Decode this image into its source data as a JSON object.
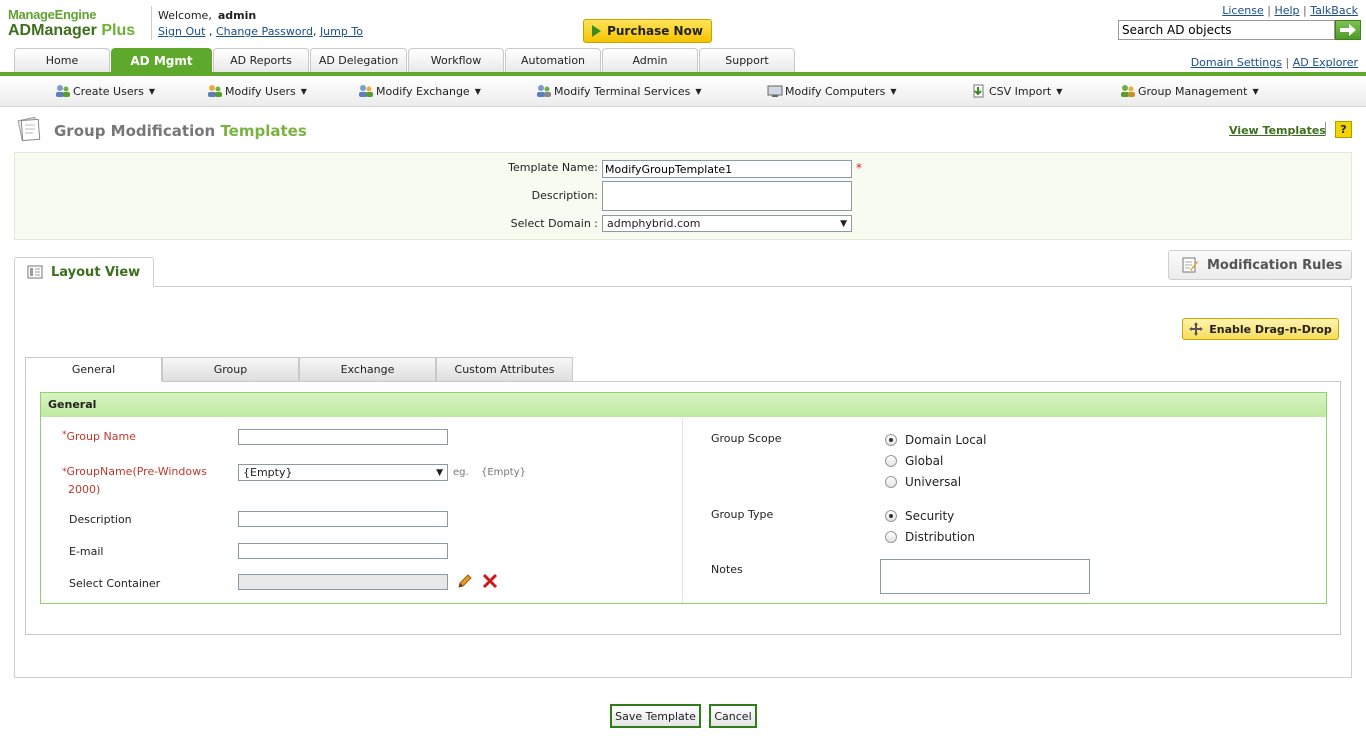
{
  "brand": {
    "top": "ManageEngine",
    "bottom": "ADManager",
    "plus": "Plus"
  },
  "header": {
    "welcome_text": "Welcome,",
    "username": "admin",
    "sign_out": "Sign Out",
    "change_password": "Change Password",
    "jump_to": "Jump To",
    "purchase": "Purchase Now",
    "license": "License",
    "help": "Help",
    "talkback": "TalkBack",
    "search_value": "Search AD objects",
    "domain_settings": "Domain Settings",
    "ad_explorer": "AD Explorer"
  },
  "main_tabs": [
    "Home",
    "AD Mgmt",
    "AD Reports",
    "AD Delegation",
    "Workflow",
    "Automation",
    "Admin",
    "Support"
  ],
  "active_main_tab": "AD Mgmt",
  "submenu": [
    "Create Users",
    "Modify Users",
    "Modify Exchange",
    "Modify Terminal Services",
    "Modify Computers",
    "CSV Import",
    "Group Management"
  ],
  "page": {
    "title_main": "Group Modification",
    "title_accent": "Templates",
    "view_templates": "View Templates",
    "help": "?"
  },
  "template_form": {
    "name_label": "Template Name:",
    "name_value": "ModifyGroupTemplate1",
    "description_label": "Description:",
    "description_value": "",
    "domain_label": "Select Domain :",
    "domain_value": "admphybrid.com",
    "required_mark": "*"
  },
  "layout": {
    "layout_view": "Layout View",
    "modification_rules": "Modification Rules",
    "enable_drag": "Enable Drag-n-Drop",
    "tabs": [
      "General",
      "Group",
      "Exchange",
      "Custom Attributes"
    ],
    "active_tab": "General"
  },
  "general": {
    "heading": "General",
    "group_name": "Group Name",
    "group_name_pre_line1": "GroupName(Pre-Windows",
    "group_name_pre_line2": "2000)",
    "empty_option": "{Empty}",
    "eg": "eg.",
    "eg_value": "{Empty}",
    "description": "Description",
    "email": "E-mail",
    "select_container": "Select Container",
    "group_scope": "Group Scope",
    "scope_options": [
      "Domain Local",
      "Global",
      "Universal"
    ],
    "scope_selected": "Domain Local",
    "group_type": "Group Type",
    "type_options": [
      "Security",
      "Distribution"
    ],
    "type_selected": "Security",
    "notes": "Notes"
  },
  "footer": {
    "save": "Save Template",
    "cancel": "Cancel"
  },
  "colors": {
    "brand_green": "#5ea92c",
    "accent_yellow": "#f5c400",
    "required_red": "#d22222"
  }
}
